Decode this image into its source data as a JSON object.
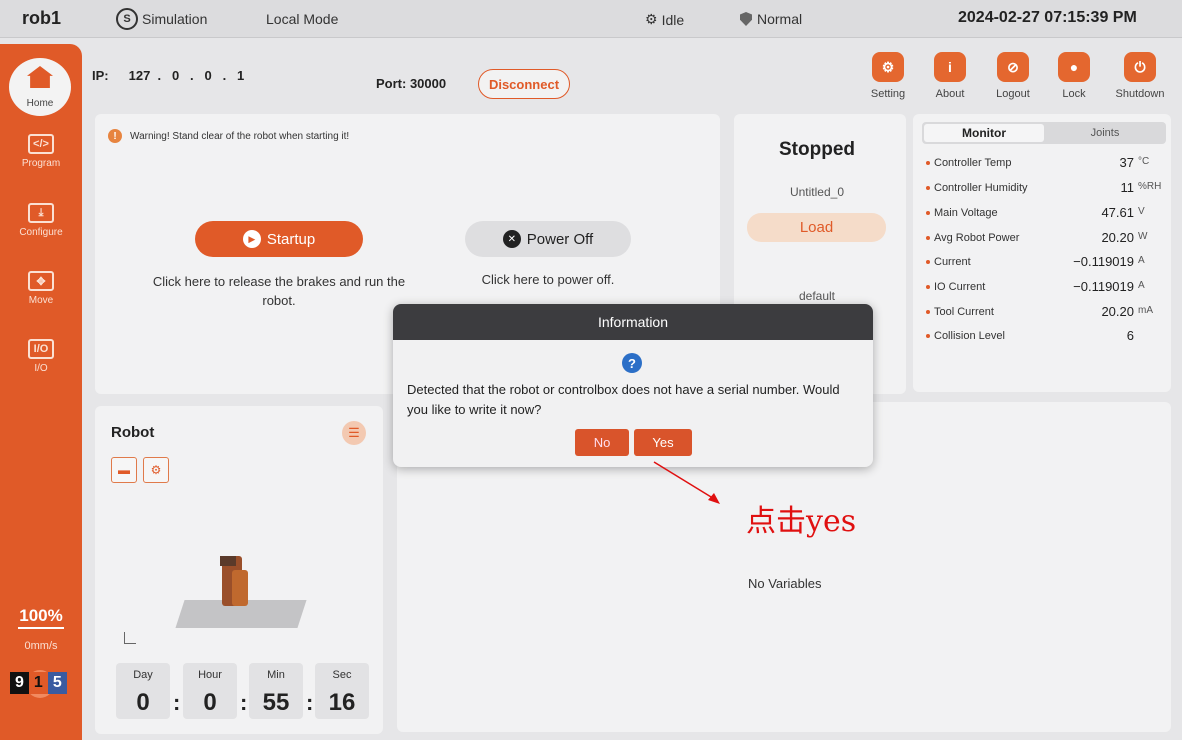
{
  "topbar": {
    "robot_name": "rob1",
    "sim_badge": "S",
    "simulation": "Simulation",
    "mode": "Local Mode",
    "status": "Idle",
    "safety": "Normal",
    "datetime": "2024-02-27 07:15:39 PM"
  },
  "sidebar": {
    "home": "Home",
    "items": [
      {
        "label": "Program",
        "icon": "</>"
      },
      {
        "label": "Configure",
        "icon": "⤓"
      },
      {
        "label": "Move",
        "icon": "✥"
      },
      {
        "label": "I/O",
        "icon": "I/O"
      }
    ],
    "speed": "100%",
    "speed_unit": "0mm/s",
    "digits": [
      "9",
      "1",
      "5"
    ]
  },
  "connection": {
    "ip_label": "IP:",
    "ip": "127  .   0   .   0   .   1",
    "port": "Port: 30000",
    "disconnect": "Disconnect"
  },
  "toolbar": [
    "Setting",
    "About",
    "Logout",
    "Lock",
    "Shutdown"
  ],
  "power_panel": {
    "warning": "Warning! Stand clear of the robot when starting it!",
    "startup": "Startup",
    "startup_hint": "Click here to release the brakes and run the robot.",
    "poweroff": "Power Off",
    "poweroff_hint": "Click here to power off."
  },
  "program_panel": {
    "state": "Stopped",
    "program": "Untitled_0",
    "load": "Load",
    "default": "default"
  },
  "monitor": {
    "tabs": [
      "Monitor",
      "Joints"
    ],
    "rows": [
      {
        "name": "Controller Temp",
        "value": "37",
        "unit": "°C"
      },
      {
        "name": "Controller Humidity",
        "value": "11",
        "unit": "%RH"
      },
      {
        "name": "Main Voltage",
        "value": "47.61",
        "unit": "V"
      },
      {
        "name": "Avg Robot Power",
        "value": "20.20",
        "unit": "W"
      },
      {
        "name": "Current",
        "value": "−0.119019",
        "unit": "A"
      },
      {
        "name": "IO Current",
        "value": "−0.119019",
        "unit": "A"
      },
      {
        "name": "Tool Current",
        "value": "20.20",
        "unit": "mA"
      },
      {
        "name": "Collision Level",
        "value": "6",
        "unit": ""
      }
    ]
  },
  "robot_panel": {
    "title": "Robot",
    "timer": {
      "labels": [
        "Day",
        "Hour",
        "Min",
        "Sec"
      ],
      "values": [
        "0",
        "0",
        "55",
        "16"
      ]
    }
  },
  "variables": {
    "empty": "No Variables"
  },
  "dialog": {
    "title": "Information",
    "message": "Detected that the robot or controlbox does not have a serial number. Would you like to write it now?",
    "no": "No",
    "yes": "Yes"
  },
  "annotation": {
    "text": "点击yes",
    "color": "#e01010"
  },
  "colors": {
    "accent": "#e05a28",
    "dialog_header": "#3c3c3f",
    "info_blue": "#2c6fc7"
  }
}
